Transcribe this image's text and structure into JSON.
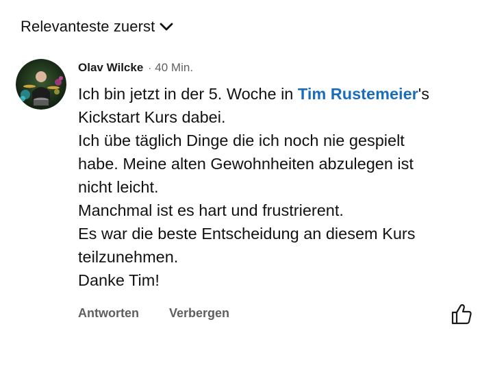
{
  "sort": {
    "label": "Relevanteste zuerst",
    "icon": "chevron-down-icon"
  },
  "comment": {
    "author": "Olav Wilcke",
    "separator": "·",
    "time": "40 Min.",
    "avatar_icon": "user-avatar",
    "lines": {
      "l1_before": "Ich bin jetzt in der 5. Woche in ",
      "l1_mention": "Tim Rustemeier",
      "l1_after": "'s",
      "l2": "Kickstart Kurs dabei.",
      "l3": "Ich übe täglich Dinge die ich noch nie gespielt",
      "l4": "habe. Meine alten Gewohnheiten abzulegen ist",
      "l5": "nicht leicht.",
      "l6": "Manchmal ist es hart und frustrierent.",
      "l7": "Es war die beste Entscheidung an diesem Kurs",
      "l8": "teilzunehmen.",
      "l9": "Danke Tim!"
    },
    "actions": {
      "reply": "Antworten",
      "hide": "Verbergen"
    },
    "like_icon": "thumbs-up-icon",
    "mention_color": "#1a6dbd"
  }
}
